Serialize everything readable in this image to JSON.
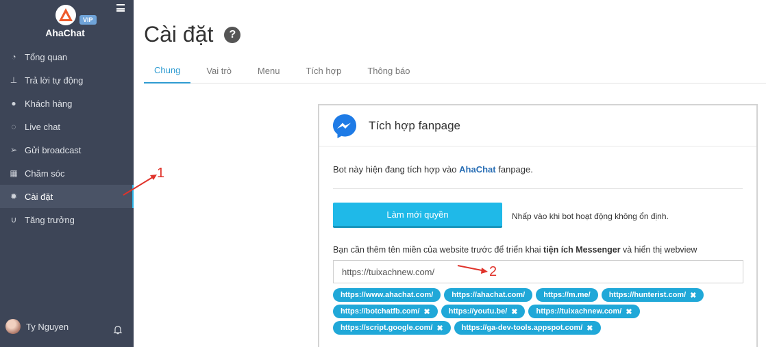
{
  "sidebar": {
    "brand": "AhaChat",
    "badge": "VIP",
    "items": [
      {
        "label": "Tổng quan",
        "icon": "dashboard-icon"
      },
      {
        "label": "Trả lời tự động",
        "icon": "sitemap-icon"
      },
      {
        "label": "Khách hàng",
        "icon": "user-icon"
      },
      {
        "label": "Live chat",
        "icon": "chat-icon"
      },
      {
        "label": "Gửi broadcast",
        "icon": "paper-plane-icon"
      },
      {
        "label": "Chăm sóc",
        "icon": "calendar-icon"
      },
      {
        "label": "Cài đặt",
        "icon": "gear-icon",
        "active": true
      },
      {
        "label": "Tăng trưởng",
        "icon": "magnet-icon"
      }
    ],
    "user": "Ty Nguyen"
  },
  "header": {
    "title": "Cài đặt",
    "tabs": [
      "Chung",
      "Vai trò",
      "Menu",
      "Tích hợp",
      "Thông báo"
    ],
    "active_tab": "Chung"
  },
  "card": {
    "title": "Tích hợp fanpage",
    "desc_prefix": "Bot này hiện đang tích hợp vào",
    "desc_brand": "AhaChat",
    "desc_suffix": "fanpage.",
    "button": "Làm mới quyền",
    "button_hint": "Nhấp vào khi bot hoạt động không ổn định.",
    "domain_note_prefix": "Bạn cần thêm tên miền của website trước để triển khai",
    "domain_note_bold": "tiện ích Messenger",
    "domain_note_suffix": "và hiển thị webview",
    "domain_value": "https://tuixachnew.com/",
    "domains": [
      "https://www.ahachat.com/",
      "https://ahachat.com/",
      "https://m.me/",
      "https://hunterist.com/",
      "https://botchatfb.com/",
      "https://youtu.be/",
      "https://tuixachnew.com/",
      "https://script.google.com/",
      "https://ga-dev-tools.appspot.com/"
    ],
    "removable": [
      false,
      false,
      false,
      true,
      true,
      true,
      true,
      true,
      true
    ]
  },
  "annotations": {
    "label1": "1",
    "label2": "2"
  },
  "colors": {
    "sidebar": "#3d4557",
    "accent": "#1fb9e8",
    "tag": "#20a8d8",
    "annotation": "#e0332b"
  }
}
